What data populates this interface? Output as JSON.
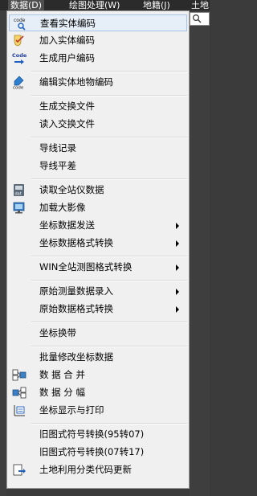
{
  "menubar": {
    "items": [
      "数据(D)",
      "绘图处理(W)",
      "地籍(J)",
      "土地"
    ]
  },
  "menu": {
    "items": [
      {
        "label": "查看实体编码",
        "icon": "code-search-icon"
      },
      {
        "label": "加入实体编码",
        "icon": "shield-check-icon"
      },
      {
        "label": "生成用户编码",
        "icon": "code-generate-icon"
      },
      {
        "label": "编辑实体地物编码",
        "icon": "code-edit-icon"
      },
      {
        "label": "生成交换文件",
        "icon": ""
      },
      {
        "label": "读入交换文件",
        "icon": ""
      },
      {
        "label": "导线记录",
        "icon": ""
      },
      {
        "label": "导线平差",
        "icon": ""
      },
      {
        "label": "读取全站仪数据",
        "icon": "total-station-icon"
      },
      {
        "label": "加载大影像",
        "icon": "image-load-icon"
      },
      {
        "label": "坐标数据发送",
        "icon": "",
        "submenu": true
      },
      {
        "label": "坐标数据格式转换",
        "icon": "",
        "submenu": true
      },
      {
        "label": "WIN全站测图格式转换",
        "icon": "",
        "submenu": true
      },
      {
        "label": "原始测量数据录入",
        "icon": "",
        "submenu": true
      },
      {
        "label": "原始数据格式转换",
        "icon": "",
        "submenu": true
      },
      {
        "label": "坐标换带",
        "icon": ""
      },
      {
        "label": "批量修改坐标数据",
        "icon": ""
      },
      {
        "label": "数 据 合 并",
        "icon": "data-merge-icon"
      },
      {
        "label": "数 据 分 幅",
        "icon": "data-split-icon"
      },
      {
        "label": "坐标显示与打印",
        "icon": "coordinate-print-icon"
      },
      {
        "label": "旧图式符号转换(95转07)",
        "icon": ""
      },
      {
        "label": "旧图式符号转换(07转17)",
        "icon": ""
      },
      {
        "label": "土地利用分类代码更新",
        "icon": "land-use-update-icon"
      }
    ]
  },
  "icon_text": {
    "code": "code",
    "code_cap": "Code",
    "dat": "dat"
  }
}
